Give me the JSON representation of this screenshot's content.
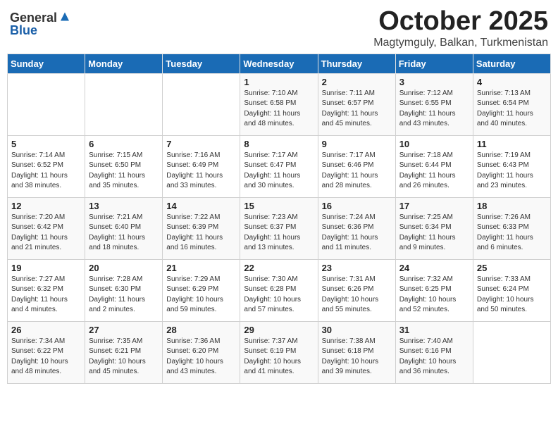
{
  "logo": {
    "general": "General",
    "blue": "Blue"
  },
  "title": {
    "month": "October 2025",
    "location": "Magtymguly, Balkan, Turkmenistan"
  },
  "days_of_week": [
    "Sunday",
    "Monday",
    "Tuesday",
    "Wednesday",
    "Thursday",
    "Friday",
    "Saturday"
  ],
  "weeks": [
    [
      {
        "day": "",
        "info": ""
      },
      {
        "day": "",
        "info": ""
      },
      {
        "day": "",
        "info": ""
      },
      {
        "day": "1",
        "info": "Sunrise: 7:10 AM\nSunset: 6:58 PM\nDaylight: 11 hours\nand 48 minutes."
      },
      {
        "day": "2",
        "info": "Sunrise: 7:11 AM\nSunset: 6:57 PM\nDaylight: 11 hours\nand 45 minutes."
      },
      {
        "day": "3",
        "info": "Sunrise: 7:12 AM\nSunset: 6:55 PM\nDaylight: 11 hours\nand 43 minutes."
      },
      {
        "day": "4",
        "info": "Sunrise: 7:13 AM\nSunset: 6:54 PM\nDaylight: 11 hours\nand 40 minutes."
      }
    ],
    [
      {
        "day": "5",
        "info": "Sunrise: 7:14 AM\nSunset: 6:52 PM\nDaylight: 11 hours\nand 38 minutes."
      },
      {
        "day": "6",
        "info": "Sunrise: 7:15 AM\nSunset: 6:50 PM\nDaylight: 11 hours\nand 35 minutes."
      },
      {
        "day": "7",
        "info": "Sunrise: 7:16 AM\nSunset: 6:49 PM\nDaylight: 11 hours\nand 33 minutes."
      },
      {
        "day": "8",
        "info": "Sunrise: 7:17 AM\nSunset: 6:47 PM\nDaylight: 11 hours\nand 30 minutes."
      },
      {
        "day": "9",
        "info": "Sunrise: 7:17 AM\nSunset: 6:46 PM\nDaylight: 11 hours\nand 28 minutes."
      },
      {
        "day": "10",
        "info": "Sunrise: 7:18 AM\nSunset: 6:44 PM\nDaylight: 11 hours\nand 26 minutes."
      },
      {
        "day": "11",
        "info": "Sunrise: 7:19 AM\nSunset: 6:43 PM\nDaylight: 11 hours\nand 23 minutes."
      }
    ],
    [
      {
        "day": "12",
        "info": "Sunrise: 7:20 AM\nSunset: 6:42 PM\nDaylight: 11 hours\nand 21 minutes."
      },
      {
        "day": "13",
        "info": "Sunrise: 7:21 AM\nSunset: 6:40 PM\nDaylight: 11 hours\nand 18 minutes."
      },
      {
        "day": "14",
        "info": "Sunrise: 7:22 AM\nSunset: 6:39 PM\nDaylight: 11 hours\nand 16 minutes."
      },
      {
        "day": "15",
        "info": "Sunrise: 7:23 AM\nSunset: 6:37 PM\nDaylight: 11 hours\nand 13 minutes."
      },
      {
        "day": "16",
        "info": "Sunrise: 7:24 AM\nSunset: 6:36 PM\nDaylight: 11 hours\nand 11 minutes."
      },
      {
        "day": "17",
        "info": "Sunrise: 7:25 AM\nSunset: 6:34 PM\nDaylight: 11 hours\nand 9 minutes."
      },
      {
        "day": "18",
        "info": "Sunrise: 7:26 AM\nSunset: 6:33 PM\nDaylight: 11 hours\nand 6 minutes."
      }
    ],
    [
      {
        "day": "19",
        "info": "Sunrise: 7:27 AM\nSunset: 6:32 PM\nDaylight: 11 hours\nand 4 minutes."
      },
      {
        "day": "20",
        "info": "Sunrise: 7:28 AM\nSunset: 6:30 PM\nDaylight: 11 hours\nand 2 minutes."
      },
      {
        "day": "21",
        "info": "Sunrise: 7:29 AM\nSunset: 6:29 PM\nDaylight: 10 hours\nand 59 minutes."
      },
      {
        "day": "22",
        "info": "Sunrise: 7:30 AM\nSunset: 6:28 PM\nDaylight: 10 hours\nand 57 minutes."
      },
      {
        "day": "23",
        "info": "Sunrise: 7:31 AM\nSunset: 6:26 PM\nDaylight: 10 hours\nand 55 minutes."
      },
      {
        "day": "24",
        "info": "Sunrise: 7:32 AM\nSunset: 6:25 PM\nDaylight: 10 hours\nand 52 minutes."
      },
      {
        "day": "25",
        "info": "Sunrise: 7:33 AM\nSunset: 6:24 PM\nDaylight: 10 hours\nand 50 minutes."
      }
    ],
    [
      {
        "day": "26",
        "info": "Sunrise: 7:34 AM\nSunset: 6:22 PM\nDaylight: 10 hours\nand 48 minutes."
      },
      {
        "day": "27",
        "info": "Sunrise: 7:35 AM\nSunset: 6:21 PM\nDaylight: 10 hours\nand 45 minutes."
      },
      {
        "day": "28",
        "info": "Sunrise: 7:36 AM\nSunset: 6:20 PM\nDaylight: 10 hours\nand 43 minutes."
      },
      {
        "day": "29",
        "info": "Sunrise: 7:37 AM\nSunset: 6:19 PM\nDaylight: 10 hours\nand 41 minutes."
      },
      {
        "day": "30",
        "info": "Sunrise: 7:38 AM\nSunset: 6:18 PM\nDaylight: 10 hours\nand 39 minutes."
      },
      {
        "day": "31",
        "info": "Sunrise: 7:40 AM\nSunset: 6:16 PM\nDaylight: 10 hours\nand 36 minutes."
      },
      {
        "day": "",
        "info": ""
      }
    ]
  ]
}
